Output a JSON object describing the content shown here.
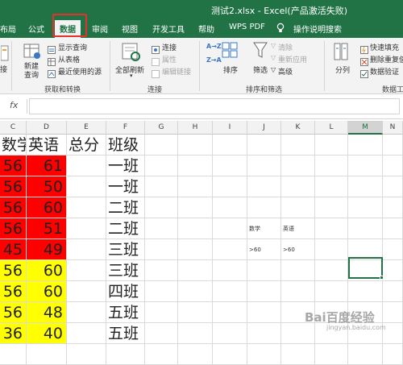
{
  "window": {
    "title": "测试2.xlsx - Excel(产品激活失败)"
  },
  "tabs": [
    {
      "label": "布局"
    },
    {
      "label": "公式"
    },
    {
      "label": "数据",
      "active": true
    },
    {
      "label": "审阅"
    },
    {
      "label": "视图"
    },
    {
      "label": "开发工具"
    },
    {
      "label": "帮助"
    },
    {
      "label": "WPS PDF"
    },
    {
      "label": "操作说明搜索"
    }
  ],
  "ribbon": {
    "left_cut": "接",
    "new_query": "新建\n查询",
    "show_queries": "显示查询",
    "from_table": "从表格",
    "recent_sources": "最近使用的源",
    "group_get_transform": "获取和转换",
    "refresh_all": "全部刷新",
    "connections": "连接",
    "properties": "属性",
    "edit_links": "编辑链接",
    "group_connections": "连接",
    "sort_az": "A→Z",
    "sort_za": "Z→A",
    "sort": "排序",
    "filter": "筛选",
    "clear": "清除",
    "reapply": "重新应用",
    "advanced": "高级",
    "group_sort_filter": "排序和筛选",
    "text_to_columns": "分列",
    "flash_fill": "快速填充",
    "remove_duplicates": "删除重复值",
    "data_validation": "数据验证",
    "group_data_tools": "数据工"
  },
  "formula_bar": {
    "fx": "fx",
    "content": ""
  },
  "columns": [
    "C",
    "D",
    "E",
    "F",
    "G",
    "H",
    "I",
    "J",
    "K",
    "L",
    "M",
    "N"
  ],
  "headers": {
    "c": "数学",
    "d": "英语",
    "e": "总分",
    "f": "班级"
  },
  "rows": [
    {
      "c": "56",
      "d": "61",
      "f": "一班"
    },
    {
      "c": "56",
      "d": "50",
      "f": "一班"
    },
    {
      "c": "56",
      "d": "60",
      "f": "二班"
    },
    {
      "c": "56",
      "d": "51",
      "f": "二班"
    },
    {
      "c": "45",
      "d": "49",
      "f": "三班"
    },
    {
      "c": "56",
      "d": "60",
      "f": "三班"
    },
    {
      "c": "56",
      "d": "60",
      "f": "四班"
    },
    {
      "c": "56",
      "d": "48",
      "f": "五班"
    },
    {
      "c": "36",
      "d": "40",
      "f": "五班"
    }
  ],
  "criteria": {
    "j_header": "数学",
    "k_header": "英语",
    "j_value": ">60",
    "k_value": ">60"
  },
  "colors": {
    "red_fill": "#ff0000",
    "yellow_fill": "#ffff00",
    "excel_green": "#217346",
    "highlight_red": "#e3312d"
  },
  "watermark": {
    "brand": "Bai百度经验",
    "url": "jingyan.baidu.com"
  }
}
